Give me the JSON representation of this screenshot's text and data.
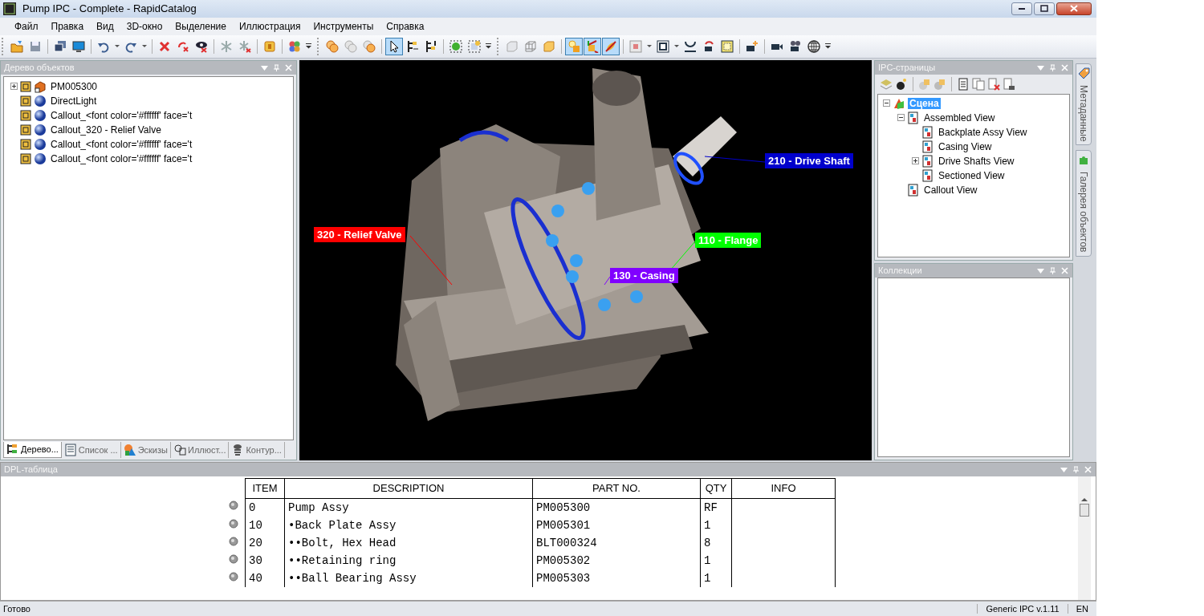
{
  "window": {
    "title": "Pump IPC - Complete - RapidCatalog"
  },
  "menu": [
    "Файл",
    "Правка",
    "Вид",
    "3D-окно",
    "Выделение",
    "Иллюстрация",
    "Инструменты",
    "Справка"
  ],
  "toolbars": [
    {
      "buttons": [
        {
          "kind": "open",
          "selected": false
        },
        {
          "kind": "save",
          "selected": false
        },
        {
          "kind": "sep"
        },
        {
          "kind": "windows",
          "selected": false
        },
        {
          "kind": "monitor",
          "selected": false
        },
        {
          "kind": "sep"
        },
        {
          "kind": "undo",
          "selected": false
        },
        {
          "kind": "caret",
          "selected": false
        },
        {
          "kind": "redo",
          "selected": false
        },
        {
          "kind": "caret",
          "selected": false
        },
        {
          "kind": "sep"
        },
        {
          "kind": "delete",
          "selected": false
        },
        {
          "kind": "delete-link",
          "selected": false
        },
        {
          "kind": "eye-delete",
          "selected": false
        },
        {
          "kind": "sep"
        },
        {
          "kind": "snowflake",
          "selected": false
        },
        {
          "kind": "snowflake-delete",
          "selected": false
        },
        {
          "kind": "sep"
        },
        {
          "kind": "tile",
          "selected": false
        },
        {
          "kind": "sep"
        },
        {
          "kind": "circles",
          "selected": false
        },
        {
          "kind": "overflow",
          "selected": false
        }
      ]
    },
    {
      "buttons": [
        {
          "kind": "ball-orange",
          "selected": false
        },
        {
          "kind": "ball-gray",
          "selected": false
        },
        {
          "kind": "ball-mixed",
          "selected": false
        },
        {
          "kind": "sep"
        },
        {
          "kind": "pointer",
          "selected": true
        },
        {
          "kind": "tree-right",
          "selected": false
        },
        {
          "kind": "tree-up",
          "selected": false
        },
        {
          "kind": "sep"
        },
        {
          "kind": "sphere-frame",
          "selected": false
        },
        {
          "kind": "box-frame",
          "selected": false
        },
        {
          "kind": "overflow",
          "selected": false
        }
      ]
    },
    {
      "buttons": [
        {
          "kind": "cube-gray",
          "selected": false
        },
        {
          "kind": "cube-wire",
          "selected": false
        },
        {
          "kind": "cube-yellow",
          "selected": false
        },
        {
          "kind": "sep"
        },
        {
          "kind": "light-box",
          "selected": true
        },
        {
          "kind": "axes-box",
          "selected": true
        },
        {
          "kind": "satellite",
          "selected": true
        },
        {
          "kind": "sep"
        },
        {
          "kind": "fit",
          "selected": false
        },
        {
          "kind": "caret",
          "selected": false
        },
        {
          "kind": "frame",
          "selected": false
        },
        {
          "kind": "caret",
          "selected": false
        },
        {
          "kind": "arc",
          "selected": false
        },
        {
          "kind": "camera-rotate",
          "selected": false
        },
        {
          "kind": "frame-yellow",
          "selected": false
        },
        {
          "kind": "sep"
        },
        {
          "kind": "camera-plus",
          "selected": false
        },
        {
          "kind": "sep"
        },
        {
          "kind": "camera",
          "selected": false
        },
        {
          "kind": "film-camera",
          "selected": false
        },
        {
          "kind": "globe",
          "selected": false
        },
        {
          "kind": "overflow",
          "selected": false
        }
      ]
    }
  ],
  "object_tree": {
    "title": "Дерево объектов",
    "items": [
      {
        "label": "PM005300",
        "kind": "assembly",
        "expanded": false
      },
      {
        "label": "DirectLight",
        "kind": "object"
      },
      {
        "label": "Callout_<font color='#ffffff'  face='t",
        "kind": "object"
      },
      {
        "label": "Callout_320 - Relief Valve",
        "kind": "object"
      },
      {
        "label": "Callout_<font color='#ffffff'  face='t",
        "kind": "object"
      },
      {
        "label": "Callout_<font color='#ffffff'  face='t",
        "kind": "object"
      }
    ],
    "tabs": [
      {
        "label": "Дерево...",
        "selected": true
      },
      {
        "label": "Список ...",
        "selected": false
      },
      {
        "label": "Эскизы",
        "selected": false
      },
      {
        "label": "Иллюст...",
        "selected": false
      },
      {
        "label": "Контур...",
        "selected": false
      }
    ]
  },
  "viewport": {
    "callouts": [
      {
        "text": "210 - Drive Shaft",
        "color": "#0000cc"
      },
      {
        "text": "320 - Relief Valve",
        "color": "#ff0000"
      },
      {
        "text": "110 - Flange",
        "color": "#00ff00"
      },
      {
        "text": "130 - Casing",
        "color": "#8000ff"
      }
    ]
  },
  "ipc_pages": {
    "title": "IPC-страницы",
    "tree": [
      {
        "label": "Сцена",
        "kind": "scene",
        "selected": true,
        "expanded": true,
        "children": [
          {
            "label": "Assembled View",
            "kind": "page",
            "selected": false,
            "expanded": true,
            "children": [
              {
                "label": "Backplate Assy View",
                "kind": "page",
                "selected": false
              },
              {
                "label": "Casing View",
                "kind": "page",
                "selected": false
              },
              {
                "label": "Drive Shafts View",
                "kind": "page",
                "selected": false,
                "expanded": false
              },
              {
                "label": "Sectioned View",
                "kind": "page",
                "selected": false
              }
            ]
          },
          {
            "label": "Callout View",
            "kind": "page",
            "selected": false
          }
        ]
      }
    ]
  },
  "collections": {
    "title": "Коллекции"
  },
  "side_tabs": [
    {
      "label": "Метаданные"
    },
    {
      "label": "Галерея объектов"
    }
  ],
  "dpl": {
    "title": "DPL-таблица",
    "columns": [
      "ITEM",
      "DESCRIPTION",
      "PART NO.",
      "QTY",
      "INFO"
    ],
    "rows": [
      [
        "0",
        "Pump Assy",
        "PM005300",
        "RF",
        ""
      ],
      [
        "10",
        "•Back Plate Assy",
        "PM005301",
        "1",
        ""
      ],
      [
        "20",
        "••Bolt, Hex Head",
        "BLT000324",
        "8",
        ""
      ],
      [
        "30",
        "••Retaining ring",
        "PM005302",
        "1",
        ""
      ],
      [
        "40",
        "••Ball Bearing Assy",
        "PM005303",
        "1",
        ""
      ]
    ]
  },
  "status_bar": {
    "message": "Готово",
    "version": "Generic IPC v.1.11",
    "language": "EN"
  }
}
